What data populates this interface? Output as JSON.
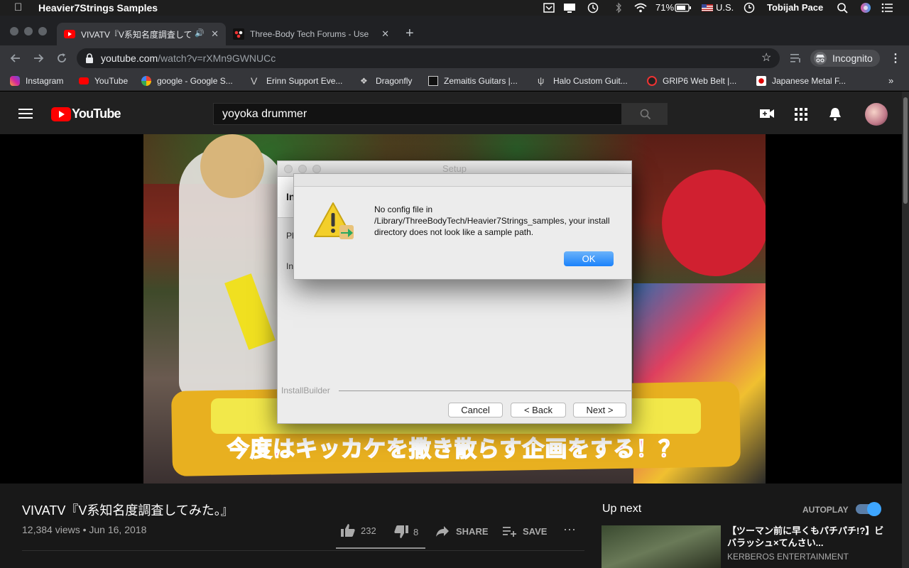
{
  "menubar": {
    "app_name": "Heavier7Strings Samples",
    "battery": "71%",
    "input_source": "U.S.",
    "user": "Tobijah Pace"
  },
  "browser": {
    "tabs": [
      {
        "title": "VIVATV『V系知名度調査して",
        "active": true
      },
      {
        "title": "Three-Body Tech Forums - Use",
        "active": false
      }
    ],
    "url_domain": "youtube.com",
    "url_path": "/watch?v=rXMn9GWNUCc",
    "profile_label": "Incognito",
    "bookmarks": [
      {
        "label": "Instagram",
        "icon": "instagram-icon"
      },
      {
        "label": "YouTube",
        "icon": "youtube-icon"
      },
      {
        "label": "google - Google S...",
        "icon": "google-icon"
      },
      {
        "label": "Erinn Support Eve...",
        "icon": "erinn-icon"
      },
      {
        "label": "Dragonfly",
        "icon": "dragonfly-icon"
      },
      {
        "label": "Zemaitis Guitars |...",
        "icon": "zemaitis-icon"
      },
      {
        "label": "Halo Custom Guit...",
        "icon": "halo-icon"
      },
      {
        "label": "GRIP6 Web Belt |...",
        "icon": "grip6-icon"
      },
      {
        "label": "Japanese Metal F...",
        "icon": "japan-flag-icon"
      }
    ]
  },
  "youtube": {
    "logo_text": "YouTube",
    "search_value": "yoyoka drummer",
    "video_caption": "今度はキッカケを撒き散らす企画をする！？",
    "video_title": "VIVATV『V系知名度調査してみた。』",
    "views_date": "12,384 views • Jun 16, 2018",
    "likes": "232",
    "dislikes": "8",
    "share_label": "SHARE",
    "save_label": "SAVE",
    "up_next_label": "Up next",
    "autoplay_label": "AUTOPLAY",
    "up_next_title": "【ツーマン前に早くもパチパチ!?】ビバラッシュ×てんさい...",
    "up_next_channel": "KERBEROS ENTERTAINMENT"
  },
  "setup_window": {
    "title": "Setup",
    "heading_fragment": "In",
    "line1_fragment": "Pl",
    "line2_fragment": "In",
    "footer_label": "InstallBuilder",
    "cancel_label": "Cancel",
    "back_label": "< Back",
    "next_label": "Next >"
  },
  "alert": {
    "message": "No config file in /Library/ThreeBodyTech/Heavier7Strings_samples, your install directory does not look like a sample path.",
    "ok_label": "OK"
  }
}
